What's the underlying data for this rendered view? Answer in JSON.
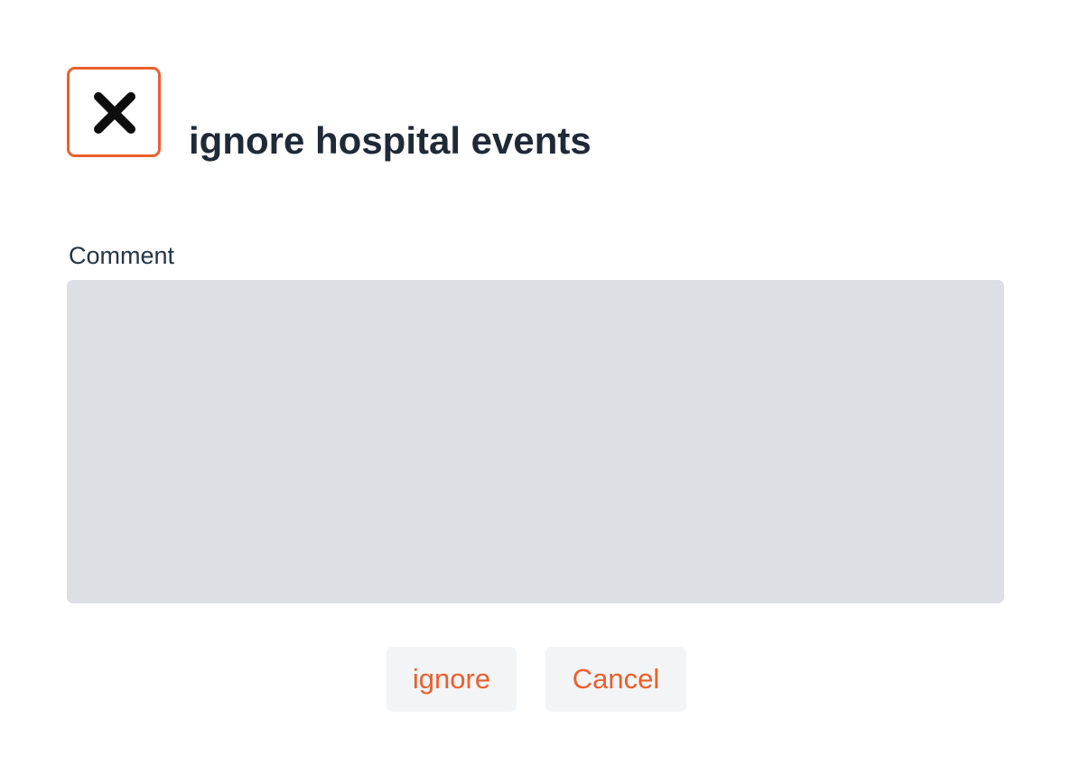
{
  "dialog": {
    "icon": "close-x-icon",
    "title": "ignore hospital events",
    "comment_label": "Comment",
    "comment_value": "",
    "comment_placeholder": "",
    "buttons": {
      "ignore_label": "ignore",
      "cancel_label": "Cancel"
    }
  },
  "colors": {
    "accent": "#ec5f2b",
    "title_text": "#1f2937",
    "textarea_bg": "#dcdfe3",
    "button_bg": "#f3f4f6"
  }
}
